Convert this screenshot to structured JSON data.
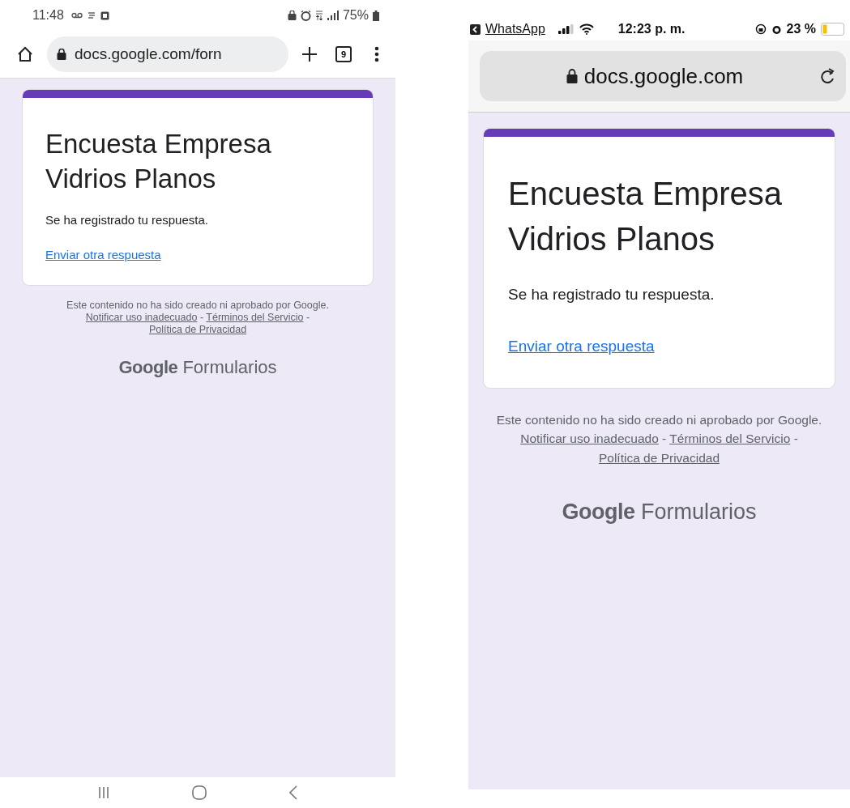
{
  "phones": [
    {
      "kind": "android",
      "status_bar": {
        "time": "11:48",
        "battery": "75%"
      },
      "toolbar": {
        "url": "docs.google.com/forn",
        "tab_count": "9"
      },
      "form": {
        "title": "Encuesta Empresa Vidrios Planos",
        "message": "Se ha registrado tu respuesta.",
        "link": "Enviar otra respuesta"
      },
      "footer": {
        "notice": "Este contenido no ha sido creado ni aprobado por Google.",
        "separator": "-",
        "links": [
          "Notificar uso inadecuado",
          "Términos del Servicio",
          "Política de Privacidad"
        ]
      },
      "brand": {
        "logo": "Google",
        "product": "Formularios"
      }
    },
    {
      "kind": "ios",
      "status_bar": {
        "back_app": "WhatsApp",
        "time": "12:23 p. m.",
        "battery": "23 %"
      },
      "toolbar": {
        "url": "docs.google.com"
      },
      "form": {
        "title": "Encuesta Empresa Vidrios Planos",
        "message": "Se ha registrado tu respuesta.",
        "link": "Enviar otra respuesta"
      },
      "footer": {
        "notice": "Este contenido no ha sido creado ni aprobado por Google.",
        "separator": "-",
        "links": [
          "Notificar uso inadecuado",
          "Términos del Servicio",
          "Política de Privacidad"
        ]
      },
      "brand": {
        "logo": "Google",
        "product": "Formularios"
      }
    }
  ]
}
